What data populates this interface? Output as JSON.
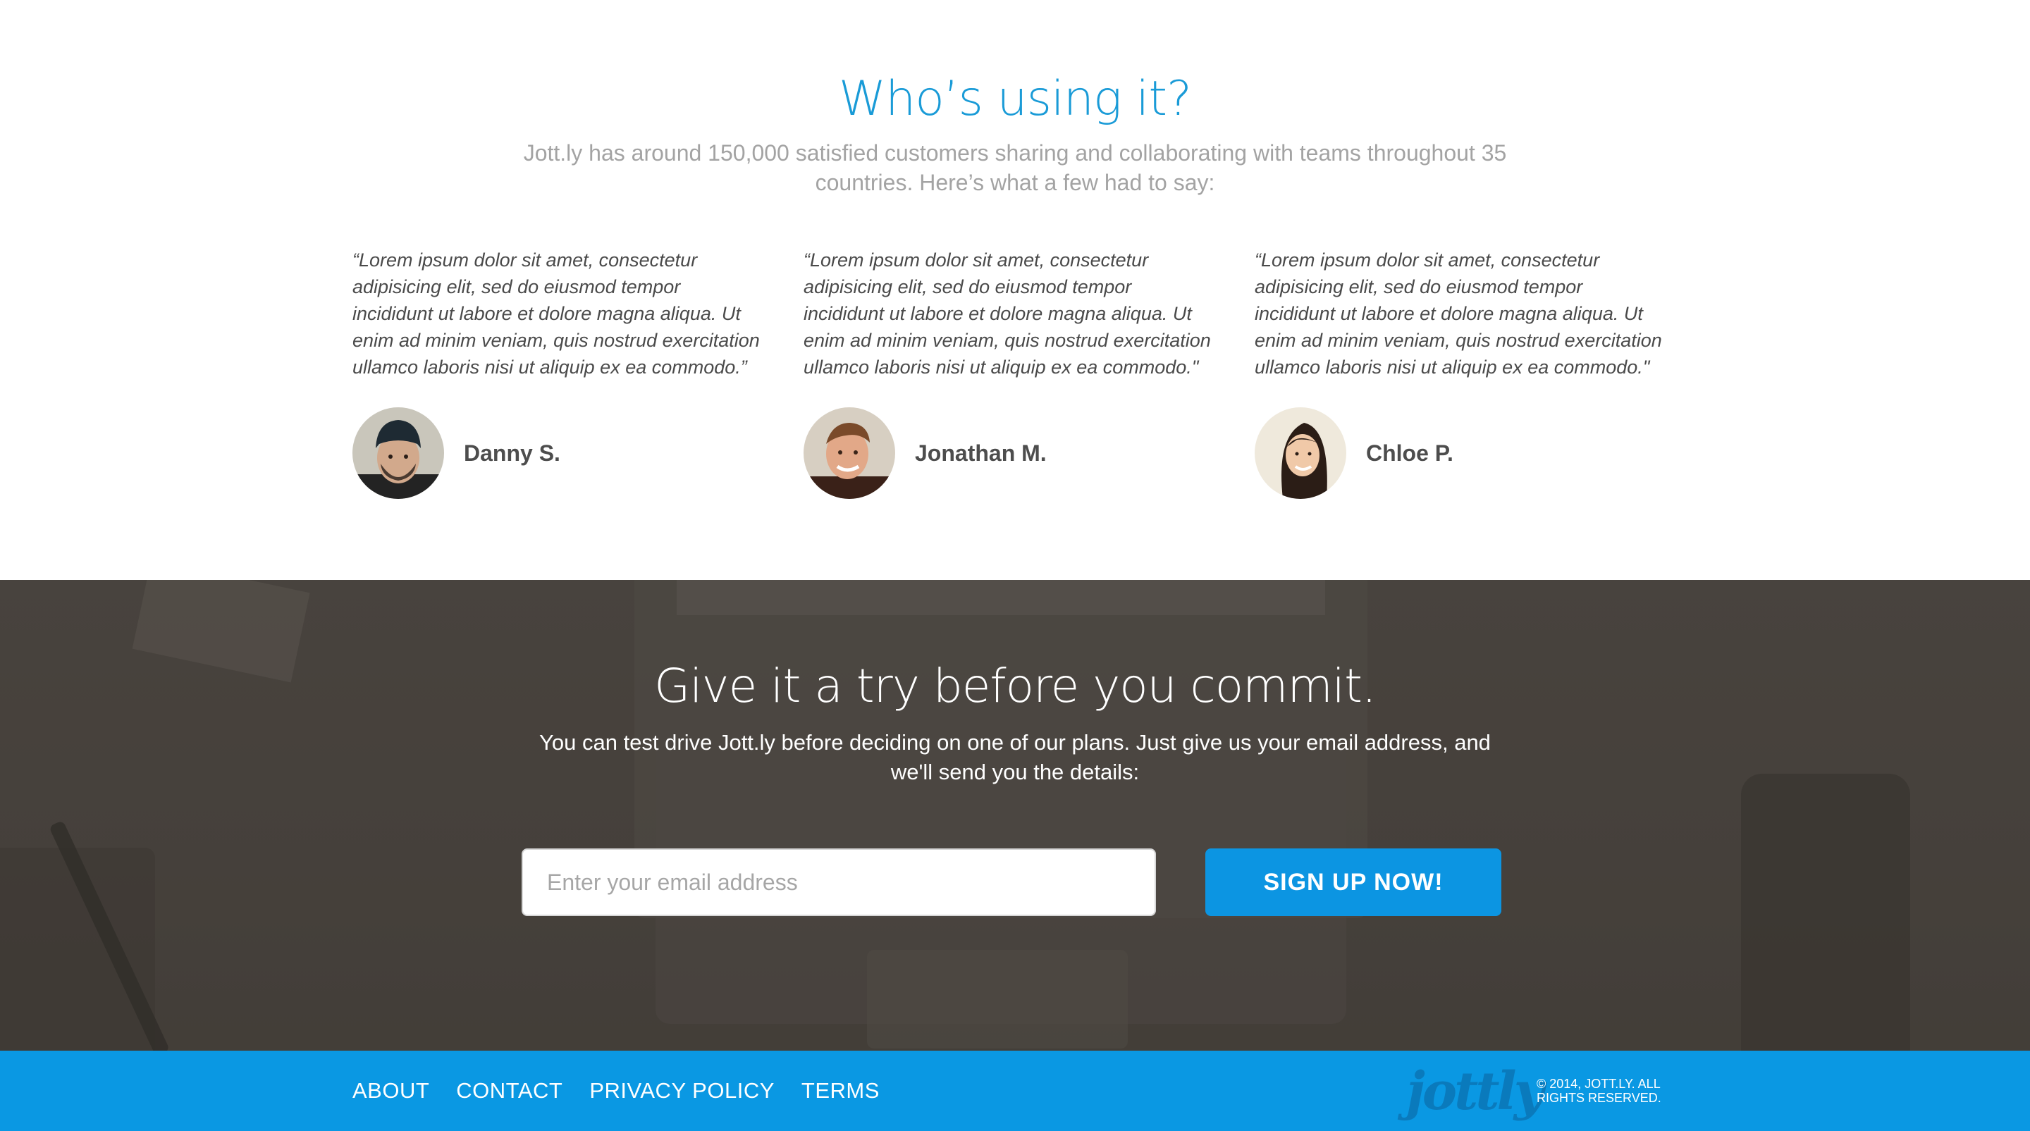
{
  "testimonials": {
    "title": "Who’s using it?",
    "subtitle": "Jott.ly has around 150,000 satisfied customers sharing and collaborating with teams throughout 35 countries. Here’s what a few had to say:",
    "items": [
      {
        "quote": "“Lorem ipsum dolor sit amet, consectetur adipisicing elit, sed do eiusmod tempor incididunt ut labore et dolore magna aliqua. Ut enim ad minim veniam, quis nostrud exercitation ullamco laboris nisi ut aliquip ex ea commodo.”",
        "name": "Danny S."
      },
      {
        "quote": "“Lorem ipsum dolor sit amet, consectetur adipisicing elit, sed do eiusmod tempor incididunt ut labore et dolore magna aliqua. Ut enim ad minim veniam, quis nostrud exercitation ullamco laboris nisi ut aliquip ex ea commodo.\"",
        "name": "Jonathan M."
      },
      {
        "quote": "“Lorem ipsum dolor sit amet, consectetur adipisicing elit, sed do eiusmod tempor incididunt ut labore et dolore magna aliqua. Ut enim ad minim veniam, quis nostrud exercitation ullamco laboris nisi ut aliquip ex ea commodo.\"",
        "name": "Chloe P."
      }
    ]
  },
  "signup": {
    "title": "Give it a try before you commit.",
    "subtitle": "You can test drive Jott.ly before deciding on one of our plans. Just give us your email address, and we'll send you the details:",
    "email_placeholder": "Enter your email address",
    "button_label": "SIGN UP NOW!"
  },
  "footer": {
    "links": [
      "ABOUT",
      "CONTACT",
      "PRIVACY POLICY",
      "TERMS"
    ],
    "logo_text": "jottly",
    "copyright": "© 2014, JOTT.LY. ALL RIGHTS RESERVED."
  },
  "colors": {
    "accent": "#1a9bd7",
    "button": "#0c95e2",
    "footer": "#0a98e3"
  }
}
